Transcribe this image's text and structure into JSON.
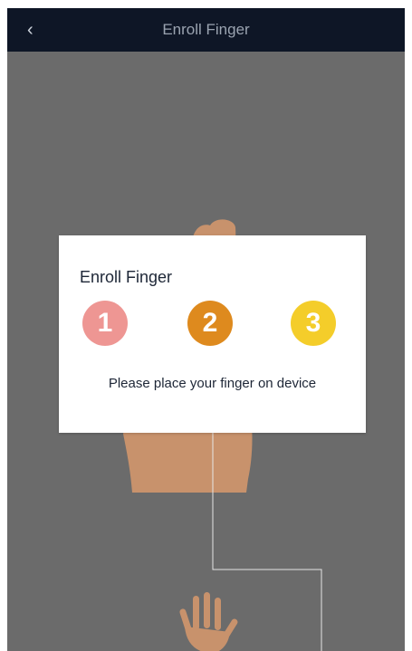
{
  "header": {
    "back_icon": "‹",
    "title": "Enroll Finger"
  },
  "dialog": {
    "title": "Enroll Finger",
    "steps": [
      "1",
      "2",
      "3"
    ],
    "message": "Please place your finger on device"
  },
  "colors": {
    "header_bg": "#0e1626",
    "overlay_bg": "#6b6b6b",
    "step_1": "#ee9693",
    "step_2": "#de8a1e",
    "step_3": "#f4cd2a"
  }
}
